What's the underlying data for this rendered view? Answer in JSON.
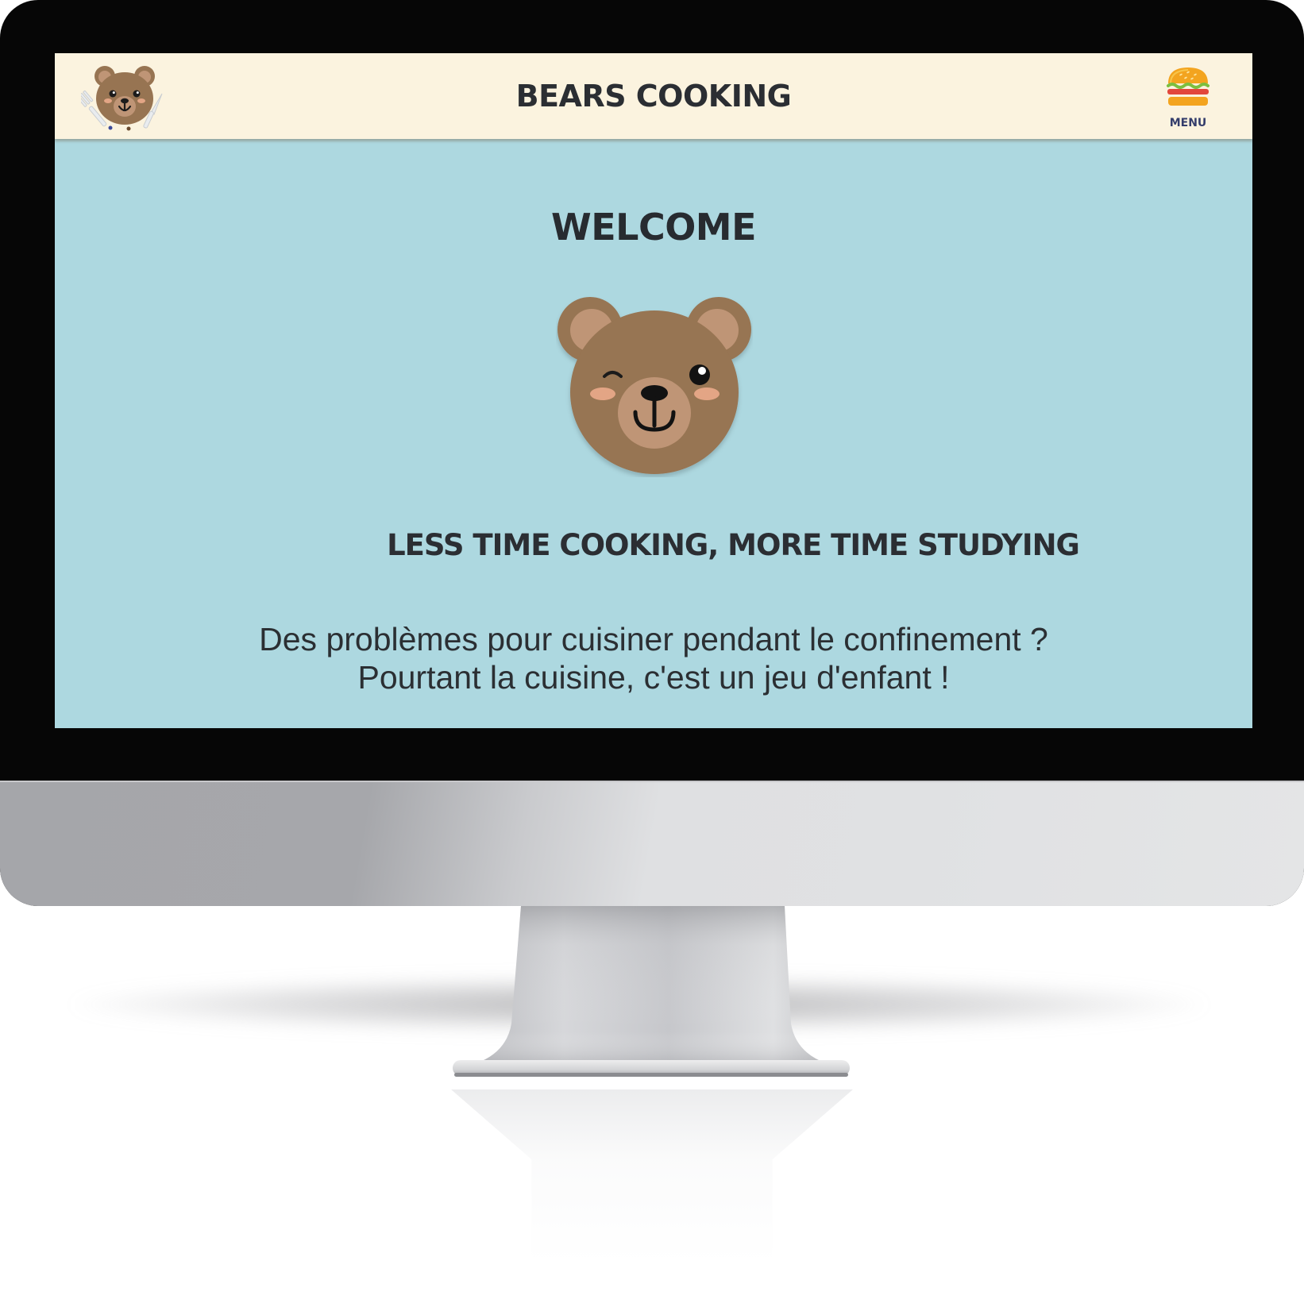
{
  "header": {
    "title": "BEARS COOKING",
    "logo_icon": "bear-chef-icon",
    "menu": {
      "icon": "burger-icon",
      "label": "MENU"
    }
  },
  "main": {
    "heading": "WELCOME",
    "mascot_icon": "winking-bear-icon",
    "tagline": "LESS TIME COOKING, MORE TIME STUDYING",
    "intro_lines": [
      "Des problèmes pour cuisiner pendant le confinement ?",
      "Pourtant la cuisine, c'est un jeu d'enfant !"
    ]
  },
  "colors": {
    "header_background": "#fbf3df",
    "page_background": "#add8e0",
    "text_dark": "#2b2e33",
    "menu_label": "#343d6b",
    "bear_brown": "#977452",
    "bear_light": "#bf9576",
    "cheek": "#e3a585"
  }
}
